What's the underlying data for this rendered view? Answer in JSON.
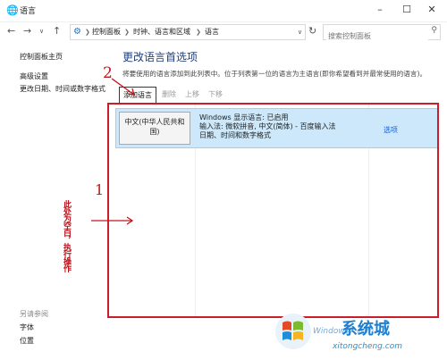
{
  "window": {
    "title": "语言"
  },
  "address_bar": {
    "crumbs": [
      "控制面板",
      "时钟、语言和区域",
      "语言"
    ],
    "search_placeholder": "搜索控制面板"
  },
  "sidebar": {
    "home": "控制面板主页",
    "advanced": "高级设置",
    "change_date": "更改日期、时间或数字格式",
    "see_also": "另请参阅",
    "fonts": "字体",
    "location": "位置"
  },
  "main": {
    "title": "更改语言首选项",
    "description": "将要使用的语言添加到此列表中。位于列表第一位的语言为主语言(即你希望看到并最常使用的语言)。",
    "toolbar": {
      "add": "添加语言",
      "remove": "删除",
      "up": "上移",
      "down": "下移"
    },
    "languages": [
      {
        "name": "中文(中华人民共和国)",
        "info_1": "Windows 显示语言: 已启用",
        "info_2": "输入法: 微软拼音, 中文(简体) - 百度输入法",
        "info_3": "日期、时间和数字格式",
        "options": "选项"
      }
    ]
  },
  "annotations": {
    "num_1": "1",
    "num_2": "2",
    "note": "此处为空白，执行操作"
  },
  "watermark": {
    "title": "系统城",
    "sub": "Windows7.com",
    "site": "xitongcheng.com"
  },
  "colors": {
    "annotation": "#cc1c2a",
    "selection": "#cce8fa",
    "link": "#1d5fc4"
  }
}
